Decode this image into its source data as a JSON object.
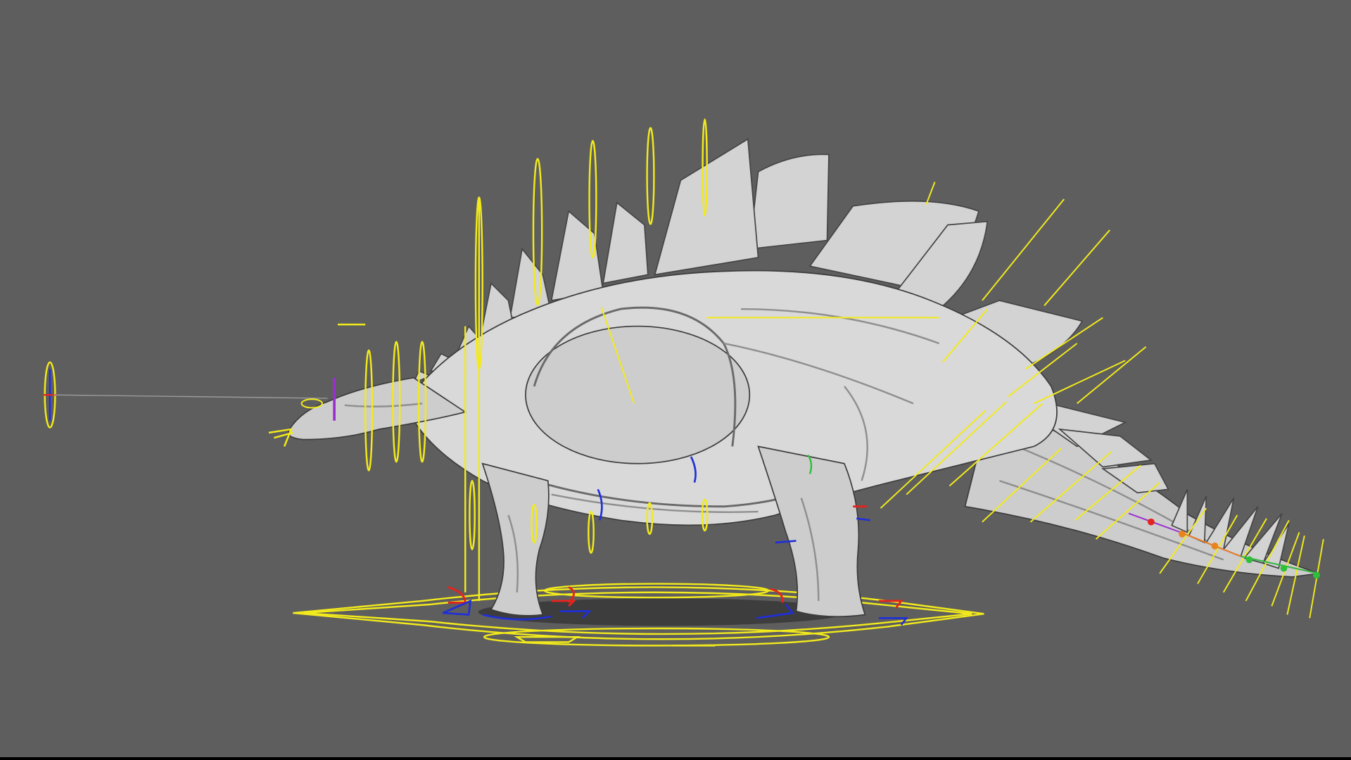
{
  "app": {
    "viewport": {
      "background": "#5e5e5e",
      "ground_shadow": "#3d3d3d",
      "subject": "stegosaurus-rig-mesh"
    },
    "colors": {
      "mesh": "#cdcdcd",
      "control_yellow": "#f2ea1c",
      "control_red": "#e3241d",
      "control_blue": "#1f2fd8",
      "tail_joint_green": "#2fbf3a",
      "tail_joint_purple": "#9b2fd0",
      "tail_joint_orange": "#e8831e"
    },
    "icons": {
      "look_at_target": "crosshair-circle-icon",
      "foot_ik": "arrow-ik-icon"
    }
  }
}
